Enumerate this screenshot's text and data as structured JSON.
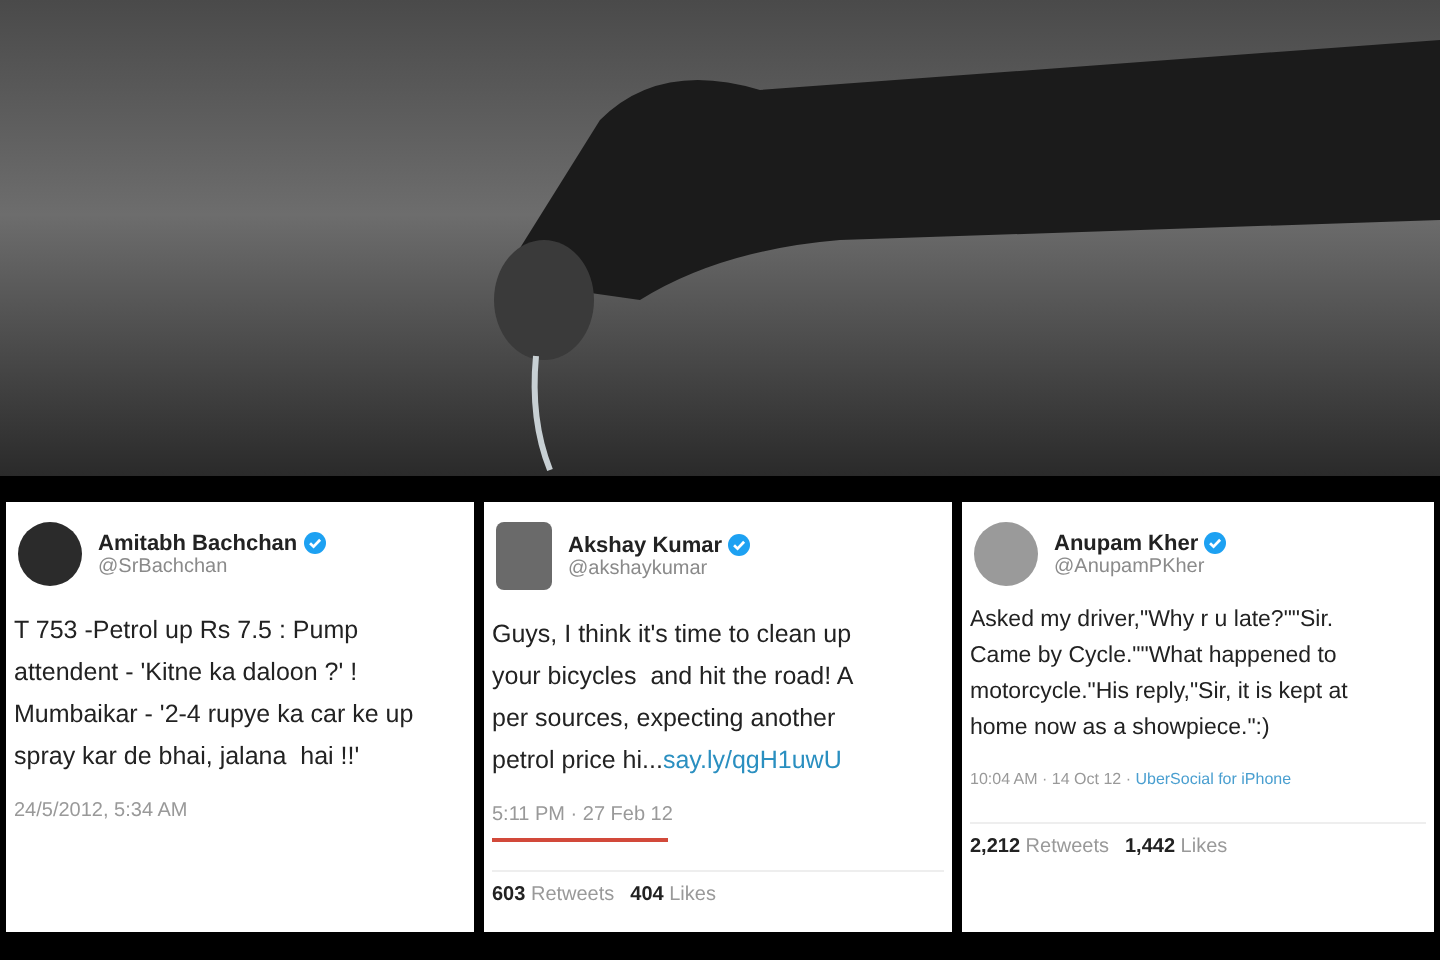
{
  "tweets": [
    {
      "name": "Amitabh Bachchan",
      "handle": "@SrBachchan",
      "verified": true,
      "lines": [
        "T 753 -Petrol up Rs 7.5 : Pump",
        "attendent - 'Kitne ka daloon ?' !",
        "Mumbaikar - '2-4 rupye ka car ke up",
        "spray kar de bhai, jalana  hai !!'"
      ],
      "time": "24/5/2012, 5:34 AM"
    },
    {
      "name": "Akshay Kumar",
      "handle": "@akshaykumar",
      "verified": true,
      "lines": [
        "Guys, I think it's time to clean up",
        "your bicycles  and hit the road! A",
        "per sources, expecting another",
        "petrol price hi..."
      ],
      "link": "say.ly/qgH1uwU",
      "time": "5:11 PM · 27 Feb 12",
      "underlined": true,
      "retweets": "603",
      "retweets_label": "Retweets",
      "likes": "404",
      "likes_label": "Likes"
    },
    {
      "name": "Anupam Kher",
      "handle": "@AnupamPKher",
      "verified": true,
      "lines": [
        "Asked my driver,\"Why r u late?\"\"Sir.",
        "Came by Cycle.\"\"What happened to",
        "motorcycle.\"His reply,\"Sir, it is kept at",
        "home now as a showpiece.\":)"
      ],
      "time": "10:04 AM · 14 Oct 12 · ",
      "source": "UberSocial for iPhone",
      "retweets": "2,212",
      "retweets_label": "Retweets",
      "likes": "1,442",
      "likes_label": "Likes"
    }
  ]
}
